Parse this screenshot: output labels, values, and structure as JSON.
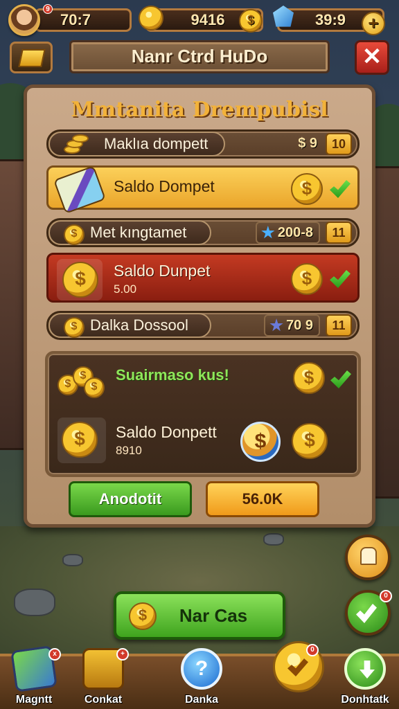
{
  "hud": {
    "level_badge": "9",
    "resource1": "70:7",
    "resource2": "9416",
    "resource3": "39:9",
    "coin_symbol": "$",
    "plus_symbol": "+"
  },
  "title_bar": {
    "title": "Nanr Ctrd HuDo",
    "close_symbol": "✕"
  },
  "panel": {
    "title": "Mmtanita Drempubisl",
    "rows": [
      {
        "label": "Maklıa dompett",
        "value": "$ 9",
        "badge": "10"
      },
      {
        "label": "Saldo Dompet"
      },
      {
        "label": "Met kıngtamet",
        "value": "200-8",
        "badge": "11"
      },
      {
        "label": "Saldo Dunpet",
        "sub": "5.00"
      },
      {
        "label": "Dalka Dossool",
        "value": "70 9",
        "badge": "11"
      }
    ],
    "reward": {
      "title": "Suairmaso kus!",
      "label": "Saldo Donpett",
      "sub": "8910"
    },
    "buttons": {
      "green": "Anodotit",
      "orange": "56.0K"
    }
  },
  "main_button": {
    "label": "Nar Cas"
  },
  "nav": {
    "items": [
      {
        "label": "Magntt"
      },
      {
        "label": "Conkat"
      },
      {
        "label": "Danka"
      },
      {
        "label": ""
      },
      {
        "label": "Donhtatk"
      }
    ],
    "badge1": "x",
    "badge2": "+",
    "badge3": "0"
  },
  "colors": {
    "panel": "#caa98a",
    "accent_gold": "#f2b23a",
    "accent_green": "#3fa41e",
    "accent_red": "#c43a22"
  }
}
